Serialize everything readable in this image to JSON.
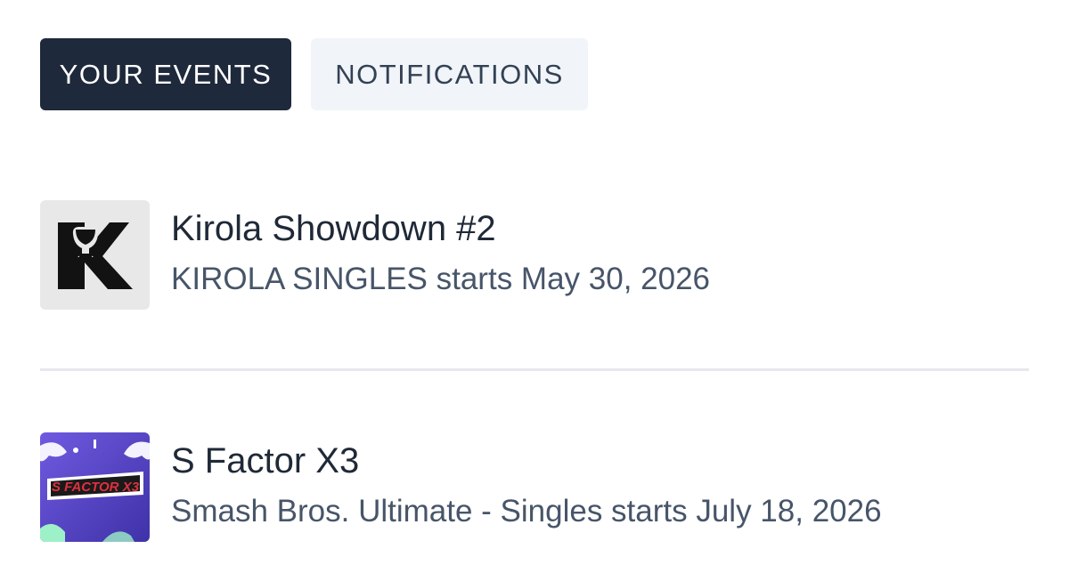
{
  "tabs": [
    {
      "label": "YOUR EVENTS",
      "active": true
    },
    {
      "label": "NOTIFICATIONS",
      "active": false
    }
  ],
  "events": [
    {
      "title": "Kirola Showdown #2",
      "subtitle": "KIROLA SINGLES starts May 30, 2026",
      "thumbnail": {
        "icon": "kirola-trophy-logo",
        "logo_text": "K",
        "bg": "#e8e8e8"
      }
    },
    {
      "title": "S Factor X3",
      "subtitle": "Smash Bros. Ultimate - Singles starts July 18, 2026",
      "thumbnail": {
        "icon": "s-factor-x3-logo",
        "logo_text": "S FACTOR X3",
        "bg": "#5b4bc4"
      }
    }
  ],
  "colors": {
    "active_tab_bg": "#1e293b",
    "inactive_tab_bg": "#f1f4f8",
    "divider": "#e6e8ee"
  }
}
